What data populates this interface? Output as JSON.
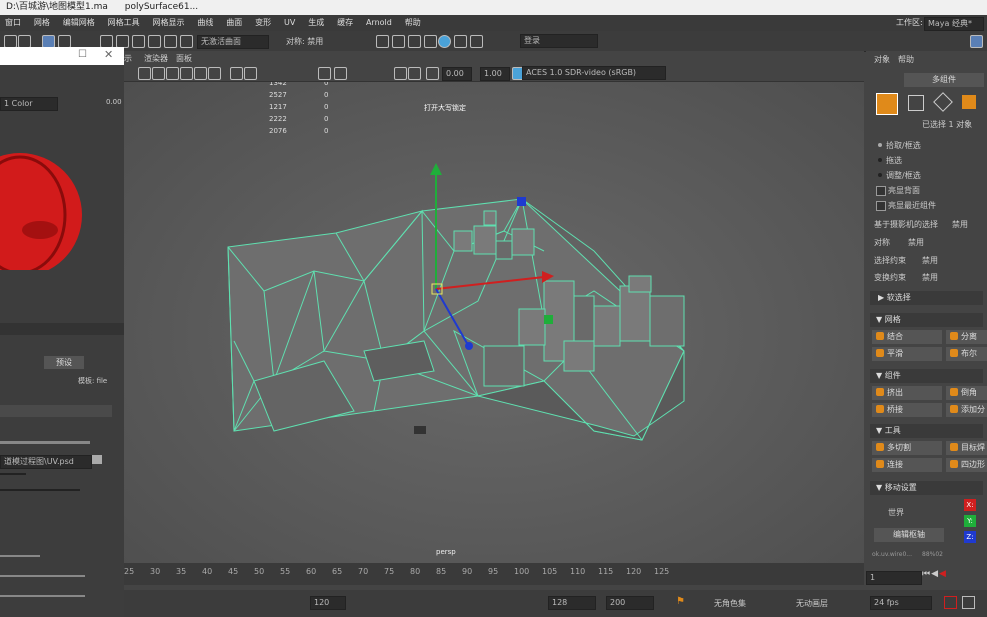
{
  "titlebar": {
    "path": "D:\\百城游\\地图模型1.ma",
    "object": "polySurface61..."
  },
  "menu": [
    "窗口",
    "网格",
    "编辑网格",
    "网格工具",
    "网格显示",
    "曲线",
    "曲面",
    "变形",
    "UV",
    "生成",
    "缓存",
    "Arnold",
    "帮助"
  ],
  "workspace": {
    "label": "工作区:",
    "value": "Maya 经典*"
  },
  "shelf": {
    "active_set": "无激活曲面",
    "symmetry": "对称: 禁用",
    "login": "登录"
  },
  "viewport": {
    "menu": [
      "示",
      "渲染器",
      "面板"
    ],
    "exposure": "0.00",
    "gamma": "1.00",
    "colorspace": "ACES 1.0 SDR-video (sRGB)",
    "stats": [
      [
        "1342",
        "0"
      ],
      [
        "2527",
        "0"
      ],
      [
        "1217",
        "0"
      ],
      [
        "2222",
        "0"
      ],
      [
        "2076",
        "0"
      ]
    ],
    "hud_message": "打开大写锁定",
    "camera": "persp"
  },
  "hypershade": {
    "color_mode": "1 Color",
    "value": "0.00",
    "preset_btn": "预设",
    "template_label": "模板: file",
    "file_path": "道模过程图\\UV.psd"
  },
  "modeling_toolkit": {
    "tabs": [
      "对象",
      "帮助"
    ],
    "multi_component": "多组件",
    "selected": "已选择 1 对象",
    "selection_modes": [
      {
        "label": "拾取/框选",
        "type": "bullet"
      },
      {
        "label": "拖选",
        "type": "dot"
      },
      {
        "label": "调整/框选",
        "type": "dot"
      },
      {
        "label": "亮显背面",
        "type": "check"
      },
      {
        "label": "亮显最近组件",
        "type": "check"
      }
    ],
    "options": [
      {
        "label": "基于摄影机的选择",
        "value": "禁用"
      },
      {
        "label": "对称",
        "value": "禁用"
      },
      {
        "label": "选择约束",
        "value": "禁用"
      },
      {
        "label": "变换约束",
        "value": "禁用"
      }
    ],
    "soft_select": "软选择",
    "sections": [
      {
        "title": "网格",
        "buttons": [
          "结合",
          "分离",
          "平滑",
          "布尔"
        ]
      },
      {
        "title": "组件",
        "buttons": [
          "挤出",
          "倒角",
          "桥接",
          "添加分"
        ]
      },
      {
        "title": "工具",
        "buttons": [
          "多切割",
          "目标焊",
          "连接",
          "四边形"
        ]
      }
    ],
    "move_settings": "移动设置",
    "world": "世界",
    "edit_pivot": "编辑枢轴",
    "axes": [
      "X:",
      "Y:",
      "Z:"
    ],
    "footer_left": "ok.uv.wire0...",
    "footer_right": "88%02"
  },
  "timeline": {
    "ticks": [
      "25",
      "30",
      "35",
      "40",
      "45",
      "50",
      "55",
      "60",
      "65",
      "70",
      "75",
      "80",
      "85",
      "90",
      "95",
      "100",
      "105",
      "110",
      "115",
      "120",
      "125"
    ],
    "current_frame": "1"
  },
  "statusbar": {
    "range_end_a": "120",
    "range_end_b": "128",
    "range_end_c": "200",
    "char_set": "无角色集",
    "anim_layer": "无动画层",
    "fps": "24 fps"
  },
  "colors": {
    "accent_orange": "#e08a1a",
    "wire_cyan": "#5fe0b0",
    "axis_x": "#d01f1f",
    "axis_y": "#1fae3a",
    "axis_z": "#1f3ad0",
    "material_red": "#d21b1b"
  }
}
